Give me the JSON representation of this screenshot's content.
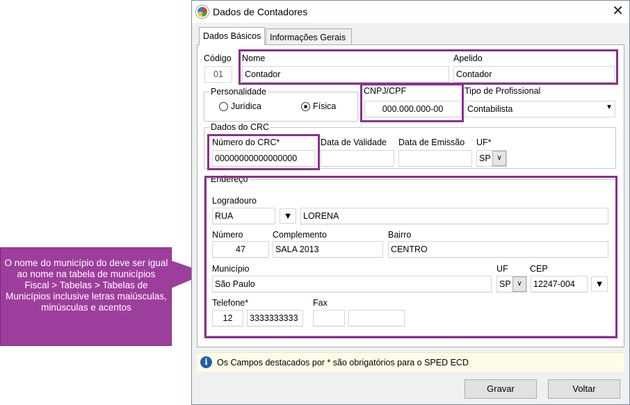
{
  "callout": {
    "text": "O nome  do município do  deve ser igual ao nome  na tabela de municípios\nFiscal > Tabelas > Tabelas de Municípios inclusive letras maiúsculas, minúsculas e acentos"
  },
  "window": {
    "title": "Dados de Contadores",
    "close_icon": "close-icon",
    "app_icon": "app-icon"
  },
  "tabs": [
    {
      "label": "Dados Básicos",
      "active": true
    },
    {
      "label": "Informações Gerais",
      "active": false
    }
  ],
  "form": {
    "codigo_label": "Código",
    "codigo_value": "01",
    "nome_label": "Nome",
    "nome_value": "Contador",
    "apelido_label": "Apelido",
    "apelido_value": "Contador",
    "personalidade_label": "Personalidade",
    "juridica_label": "Jurídica",
    "fisica_label": "Física",
    "selected_personalidade": "Física",
    "cnpj_label": "CNPJ/CPF",
    "cnpj_value": "000.000.000-00",
    "tipo_label": "Tipo de Profissional",
    "tipo_value": "Contabilista",
    "crc": {
      "group_label": "Dados do CRC",
      "numero_label": "Número do CRC*",
      "numero_value": "00000000000000000",
      "validade_label": "Data de Validade",
      "validade_value": "",
      "emissao_label": "Data de Emissão",
      "emissao_value": "",
      "uf_label": "UF*",
      "uf_value": "SP"
    },
    "endereco": {
      "group_label": "Endereço",
      "logradouro_label": "Logradouro",
      "logradouro_tipo": "RUA",
      "logradouro_nome": "LORENA",
      "numero_label": "Número",
      "numero_value": "47",
      "complemento_label": "Complemento",
      "complemento_value": "SALA 2013",
      "bairro_label": "Bairro",
      "bairro_value": "CENTRO",
      "municipio_label": "Município",
      "municipio_value": "São Paulo",
      "uf_label": "UF",
      "uf_value": "SP",
      "cep_label": "CEP",
      "cep_value": "12247-004",
      "telefone_label": "Telefone*",
      "telefone_ddd": "12",
      "telefone_numero": "3333333333",
      "fax_label": "Fax",
      "fax_ddd": "",
      "fax_numero": ""
    }
  },
  "info": {
    "text": "Os Campos destacados por * são obrigatórios para o SPED ECD",
    "icon": "info-icon"
  },
  "buttons": {
    "gravar": "Gravar",
    "voltar": "Voltar"
  },
  "colors": {
    "callout_bg": "#9e3e9c",
    "highlight_border": "#8b2f8c",
    "info_bg": "#fefce8"
  }
}
